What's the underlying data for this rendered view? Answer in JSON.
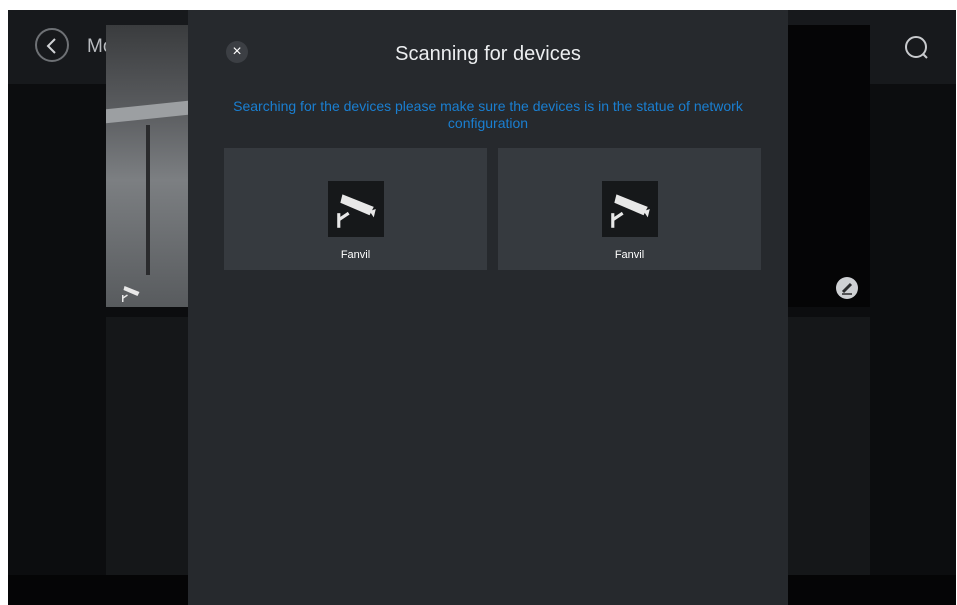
{
  "header": {
    "title": "Monitor"
  },
  "dialog": {
    "title": "Scanning for devices",
    "close_label": "×",
    "hint": "Searching for the devices please make sure the devices is in the statue of network configuration",
    "devices": [
      {
        "name": "Fanvil",
        "icon": "cctv-camera-icon"
      },
      {
        "name": "Fanvil",
        "icon": "cctv-camera-icon"
      }
    ]
  },
  "colors": {
    "accent": "#1a7fd1",
    "dialog_bg": "#26292d",
    "card_bg": "#363a3f"
  }
}
